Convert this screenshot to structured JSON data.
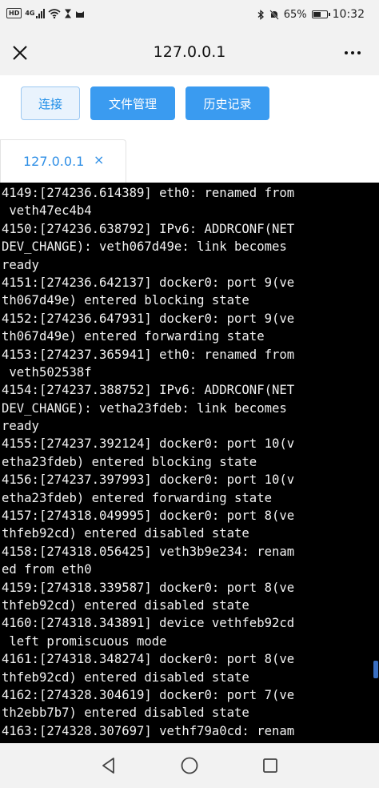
{
  "status_bar": {
    "left_badge": "HD",
    "network": "4G",
    "battery_percent_text": "65%",
    "battery_level": 0.65,
    "time": "10:32"
  },
  "title_bar": {
    "title": "127.0.0.1",
    "close_icon": "close-icon",
    "more_icon": "more-dots-icon"
  },
  "toolbar": {
    "connect_label": "连接",
    "files_label": "文件管理",
    "history_label": "历史记录"
  },
  "tabs": [
    {
      "label": "127.0.0.1",
      "close": "×"
    }
  ],
  "terminal": {
    "lines": [
      "4149:[274236.614389] eth0: renamed from",
      " veth47ec4b4",
      "4150:[274236.638792] IPv6: ADDRCONF(NET",
      "DEV_CHANGE): veth067d49e: link becomes",
      "ready",
      "4151:[274236.642137] docker0: port 9(ve",
      "th067d49e) entered blocking state",
      "4152:[274236.647931] docker0: port 9(ve",
      "th067d49e) entered forwarding state",
      "4153:[274237.365941] eth0: renamed from",
      " veth502538f",
      "4154:[274237.388752] IPv6: ADDRCONF(NET",
      "DEV_CHANGE): vetha23fdeb: link becomes",
      "ready",
      "4155:[274237.392124] docker0: port 10(v",
      "etha23fdeb) entered blocking state",
      "4156:[274237.397993] docker0: port 10(v",
      "etha23fdeb) entered forwarding state",
      "4157:[274318.049995] docker0: port 8(ve",
      "thfeb92cd) entered disabled state",
      "4158:[274318.056425] veth3b9e234: renam",
      "ed from eth0",
      "4159:[274318.339587] docker0: port 8(ve",
      "thfeb92cd) entered disabled state",
      "4160:[274318.343891] device vethfeb92cd",
      " left promiscuous mode",
      "4161:[274318.348274] docker0: port 8(ve",
      "thfeb92cd) entered disabled state",
      "4162:[274328.304619] docker0: port 7(ve",
      "th2ebb7b7) entered disabled state",
      "4163:[274328.307697] vethf79a0cd: renam"
    ]
  },
  "nav_bar": {
    "back_icon": "back-triangle-icon",
    "home_icon": "home-circle-icon",
    "recent_icon": "recent-square-icon"
  },
  "colors": {
    "accent": "#3a9bf0",
    "terminal_bg": "#000000",
    "terminal_fg": "#f2f2f2"
  }
}
